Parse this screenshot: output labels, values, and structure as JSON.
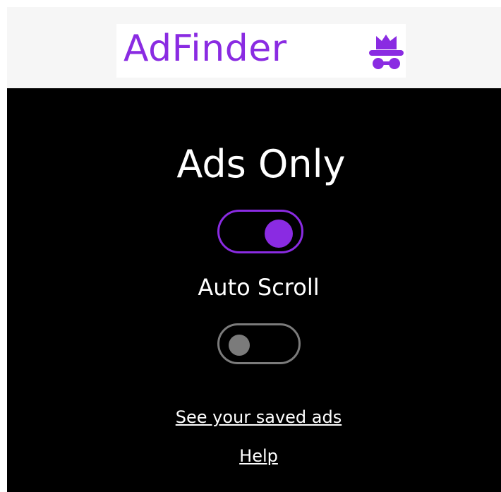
{
  "header": {
    "logo_text": "AdFinder",
    "logo_icon": "incognito-spy-icon",
    "brand_color": "#8a2be2"
  },
  "settings": {
    "ads_only": {
      "label": "Ads Only",
      "enabled": true
    },
    "auto_scroll": {
      "label": "Auto Scroll",
      "enabled": false
    }
  },
  "links": {
    "saved_ads": "See your saved ads",
    "help": "Help"
  },
  "colors": {
    "panel_background": "#000000",
    "header_background": "#f6f6f6",
    "toggle_on": "#8a2be2",
    "toggle_off": "#7b7b7b",
    "text": "#ffffff"
  }
}
